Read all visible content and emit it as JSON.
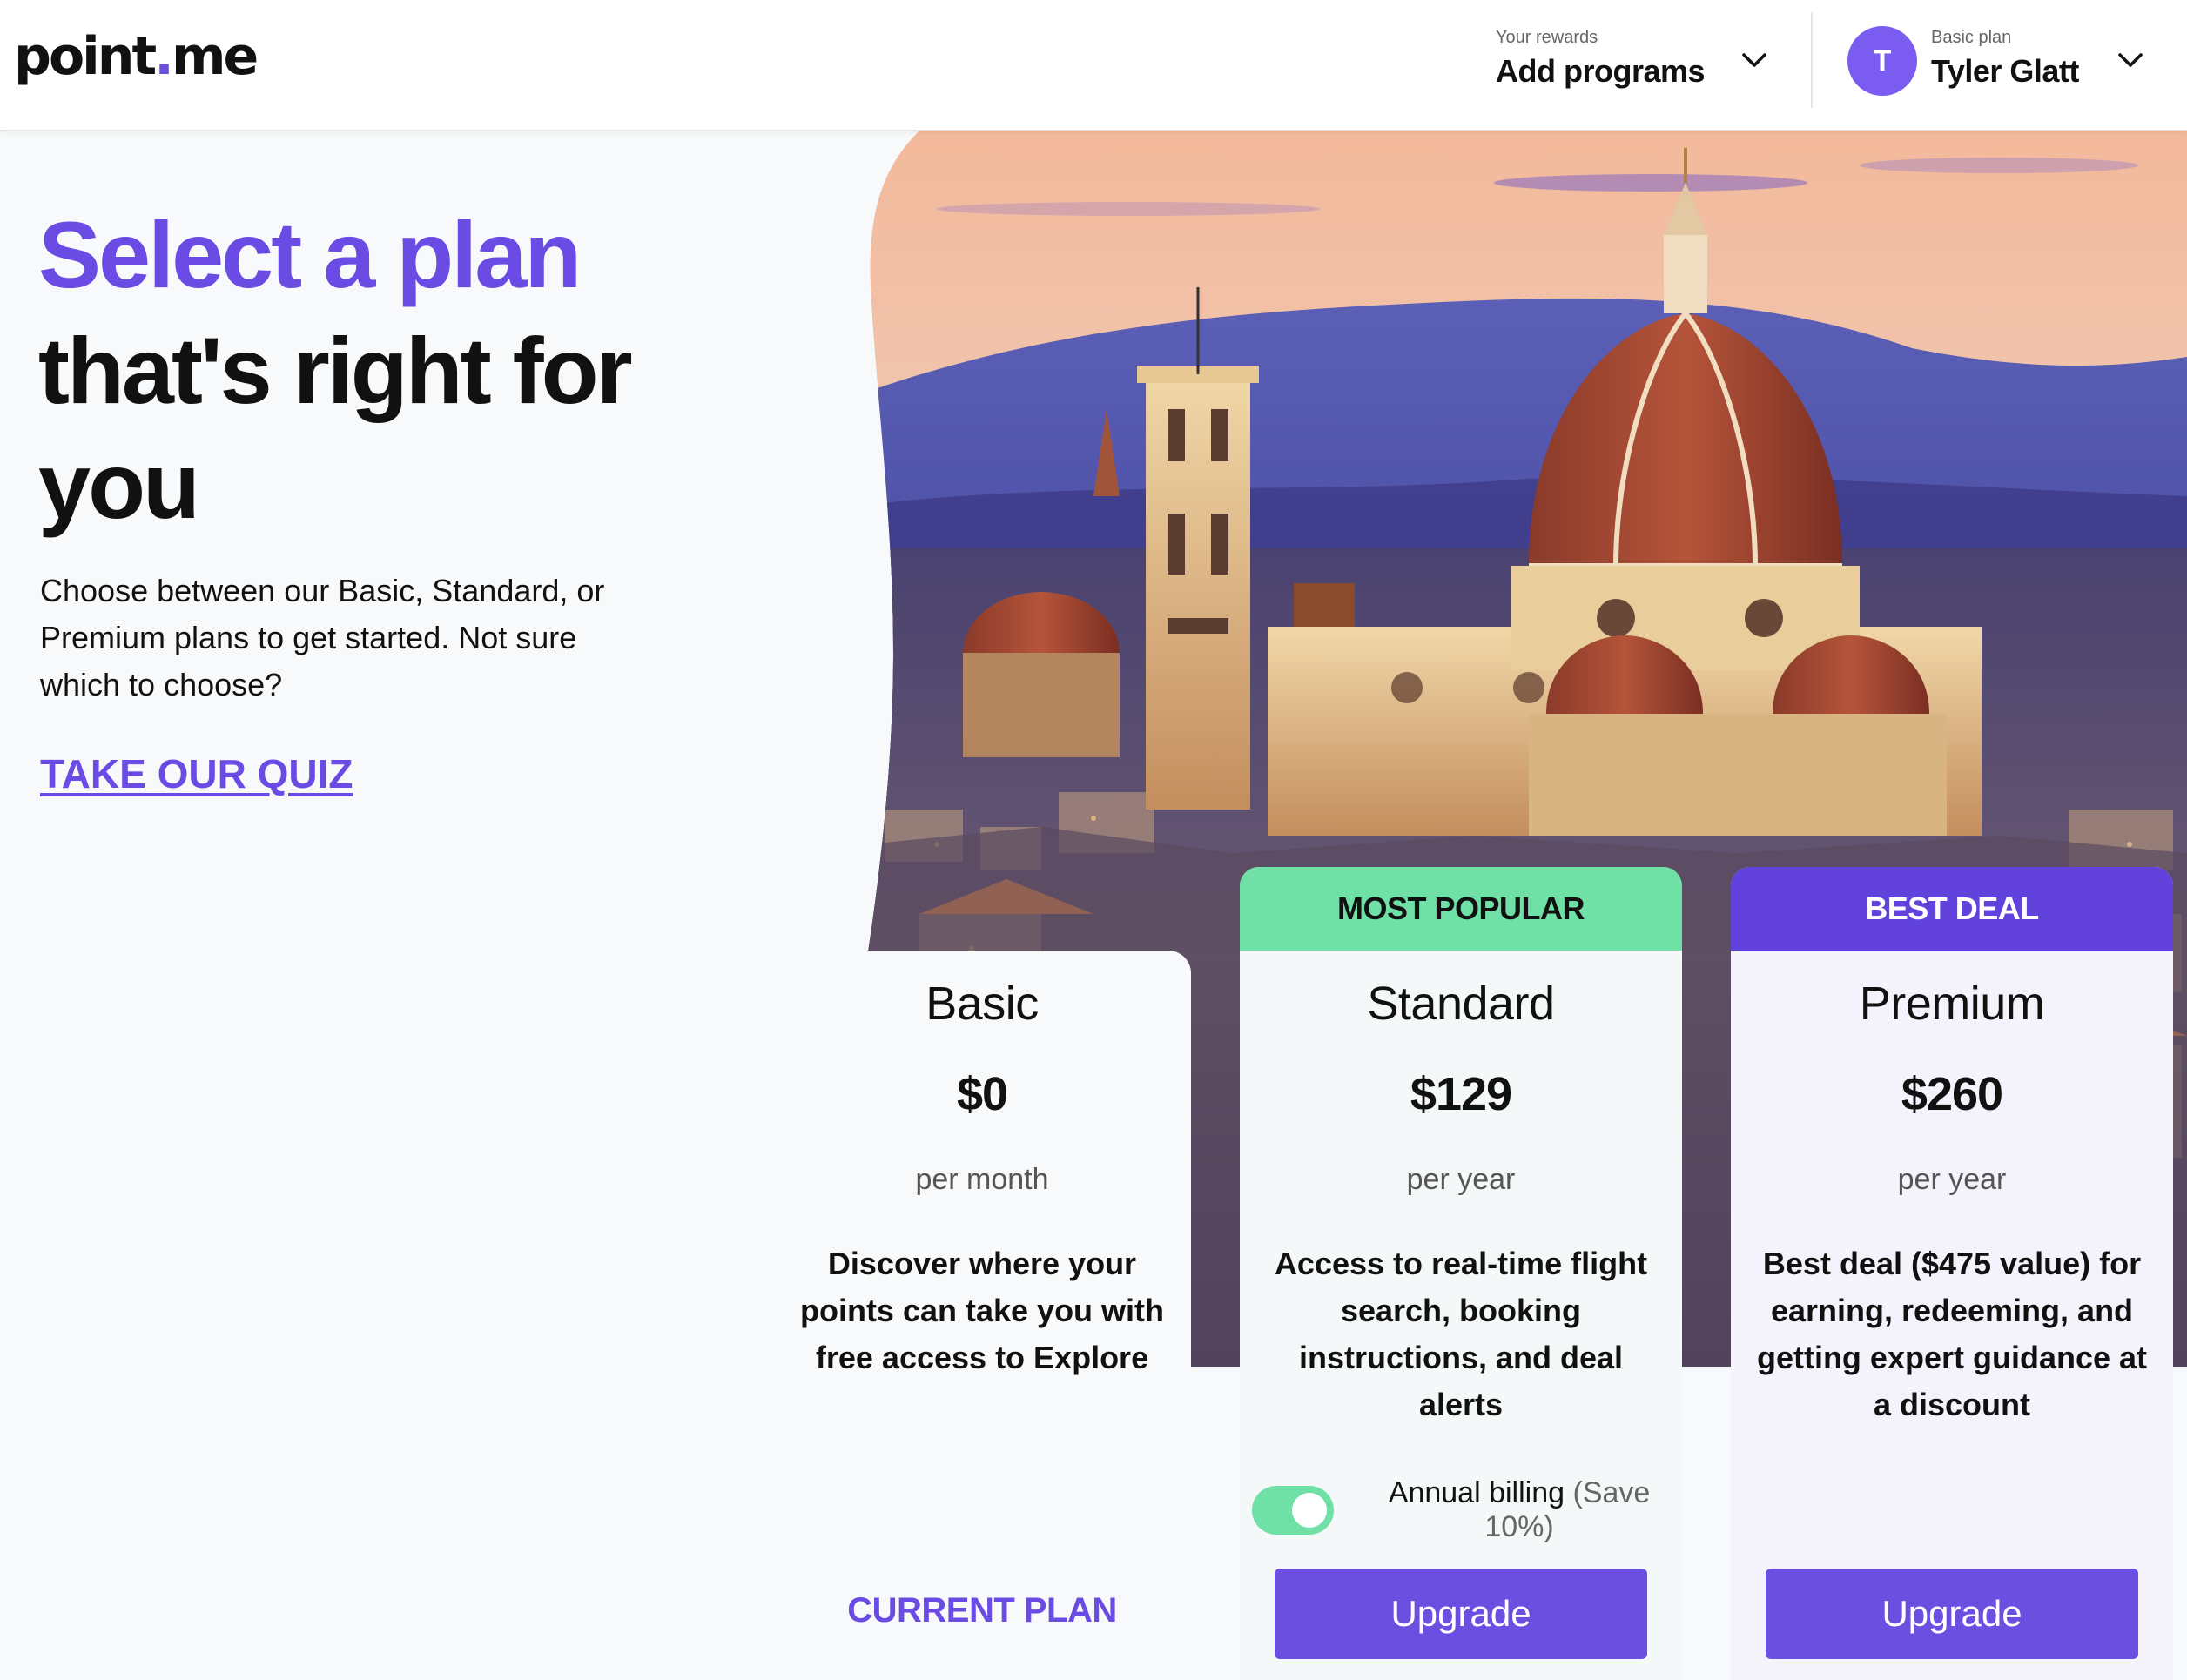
{
  "header": {
    "logo_part1": "point",
    "logo_dot": ".",
    "logo_part2": "me",
    "rewards_small": "Your rewards",
    "rewards_big": "Add programs",
    "avatar_initial": "T",
    "plan_small": "Basic plan",
    "user_name": "Tyler Glatt"
  },
  "hero": {
    "title_accent": "Select a plan",
    "title_main": "that's right for you",
    "intro": "Choose between our Basic, Standard, or Premium plans to get started. Not sure which to choose?",
    "quiz_link": "TAKE OUR QUIZ"
  },
  "plans": [
    {
      "name": "Basic",
      "price": "$0",
      "period": "per month",
      "description": "Discover where your points can take you with free access to Explore",
      "action": "CURRENT PLAN"
    },
    {
      "badge": "MOST POPULAR",
      "name": "Standard",
      "price": "$129",
      "period": "per year",
      "description": "Access to real-time flight search, booking instructions, and deal alerts",
      "toggle_label": "Annual billing",
      "toggle_save": "(Save 10%)",
      "toggle_on": true,
      "action": "Upgrade"
    },
    {
      "badge": "BEST DEAL",
      "name": "Premium",
      "price": "$260",
      "period": "per year",
      "description": "Best deal ($475 value) for earning, redeeming, and getting expert guidance at a discount",
      "action": "Upgrade"
    }
  ],
  "colors": {
    "brand_purple": "#6a4be3",
    "popular_green": "#6fe0a6",
    "deal_purple": "#6142dc"
  }
}
